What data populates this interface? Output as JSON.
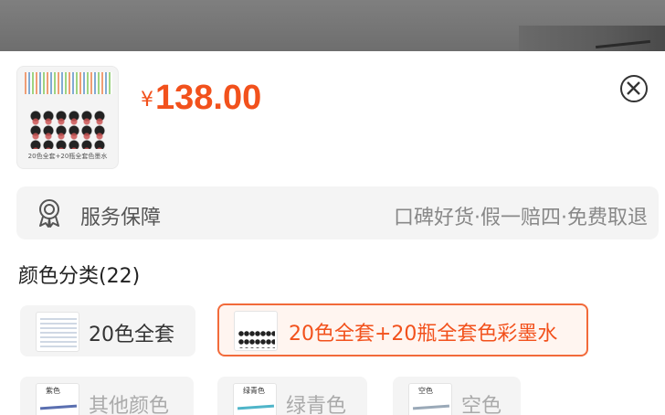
{
  "product": {
    "thumbnail_caption": "20色全套+20瓶全套色墨水",
    "currency": "¥",
    "price": "138.00"
  },
  "icons": {
    "close": "close-circle-icon",
    "service": "badge-ribbon-icon"
  },
  "service": {
    "title": "服务保障",
    "detail": "口碑好货·假一赔四·免费取退"
  },
  "variants": {
    "title": "颜色分类(22)",
    "options": [
      {
        "label": "20色全套",
        "selected": false,
        "thumb_caption": ""
      },
      {
        "label": "20色全套+20瓶全套色彩墨水",
        "selected": true,
        "thumb_caption": ""
      },
      {
        "label": "其他颜色",
        "selected": false,
        "thumb_caption": "紫色"
      },
      {
        "label": "绿青色",
        "selected": false,
        "thumb_caption": "绿青色"
      },
      {
        "label": "空色",
        "selected": false,
        "thumb_caption": "空色"
      }
    ]
  },
  "colors": {
    "accent": "#f2511c",
    "selected_border": "#f26a3a",
    "chip_bg": "#f4f4f4"
  }
}
